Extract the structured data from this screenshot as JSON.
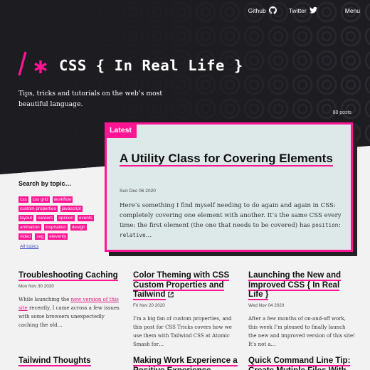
{
  "nav": {
    "github_label": "Github",
    "twitter_label": "Twitter",
    "menu_label": "Menu"
  },
  "site": {
    "title": "CSS { In Real Life }",
    "tagline": "Tips, tricks and tutorials on the web’s most beautiful language.",
    "post_count": "88 posts"
  },
  "featured": {
    "badge": "Latest",
    "title": "A Utility Class for Covering Elements",
    "date": "Sun Dec 06 2020",
    "excerpt_text": "Here’s something I find myself needing to do again and again in CSS: completely covering one element with another. It’s the same CSS every time: the first element (the one that needs to be covered) has ",
    "excerpt_code": "position: relative",
    "excerpt_end": "…"
  },
  "topics": {
    "heading": "Search by topic…",
    "tags": [
      "css",
      "css grid",
      "workflow",
      "custom properties",
      "javascript",
      "layout",
      "careers",
      "opinion",
      "events",
      "animation",
      "inspiration",
      "design",
      "video",
      "svg",
      "eleventy"
    ],
    "all_label": "All topics"
  },
  "posts": [
    {
      "title": "Troubleshooting Caching",
      "date": "Mon Nov 30 2020",
      "excerpt_before": "While launching the ",
      "excerpt_link": "new version of this site",
      "excerpt_after": " recently, I came across a few issues with some browsers unexpectedly caching the old…"
    },
    {
      "title": "Color Theming with CSS Custom Properties and Tailwind",
      "date": "Fri Nov 20 2020",
      "excerpt": "I’m a big fan of custom properties, and this post for CSS Tricks covers how we use them with Tailwind CSS at Atomic Smash for…"
    },
    {
      "title": "Launching the New and Improved CSS { In Real Life }",
      "date": "Wed Nov 04 2020",
      "excerpt": "After a few months of on-and-off work, this week I’m pleased to finally launch the new and improved version of this site! It’s not a…"
    },
    {
      "title": "Tailwind Thoughts"
    },
    {
      "title": "Making Work Experience a Positive Experience"
    },
    {
      "title": "Quick Command Line Tip: Create Mutiple Files With"
    }
  ],
  "colors": {
    "accent": "#ff1493",
    "hero_bg": "#1d1c21",
    "card_bg": "#dde9e9",
    "link": "#3b4fc6"
  },
  "icons": [
    "github-icon",
    "twitter-icon",
    "external-link-icon",
    "logo-mark"
  ]
}
